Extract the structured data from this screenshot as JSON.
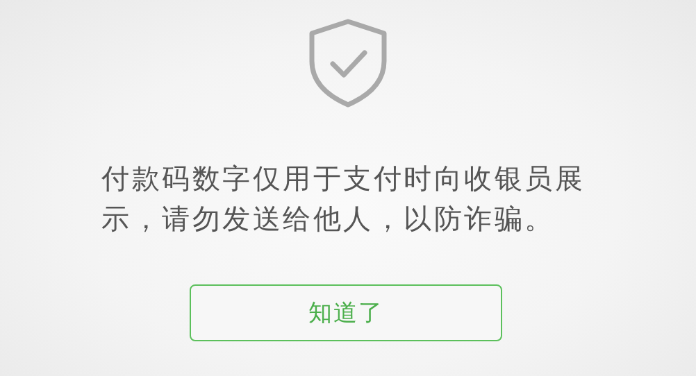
{
  "dialog": {
    "message": "付款码数字仅用于支付时向收银员展示，请勿发送给他人，以防诈骗。",
    "button": "知道了"
  }
}
